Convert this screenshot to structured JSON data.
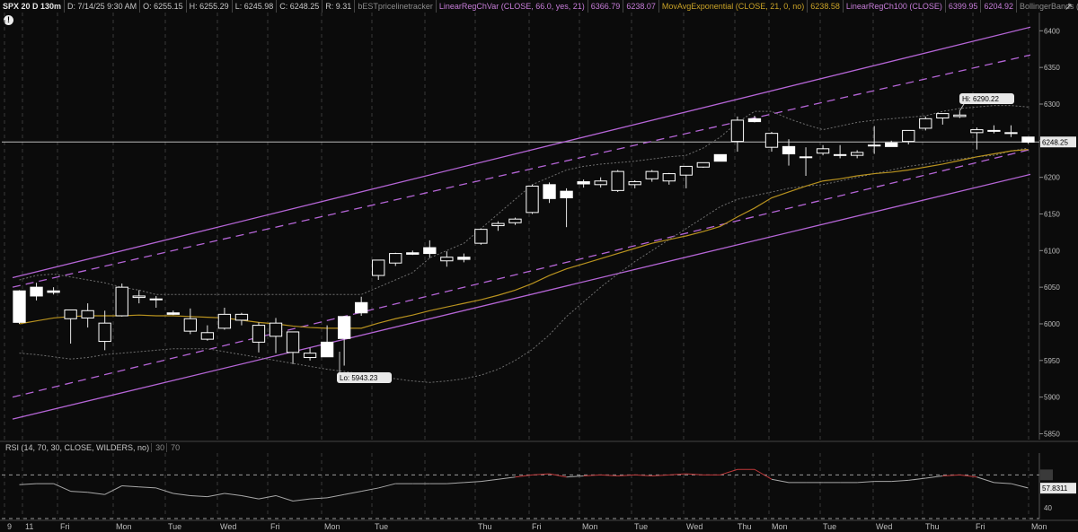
{
  "header": {
    "symbol": "SPX 20 D 130m",
    "date": "D: 7/14/25 9:30 AM",
    "open": "O: 6255.15",
    "high": "H: 6255.29",
    "low": "L: 6245.98",
    "close": "C: 6248.25",
    "range": "R: 9.31",
    "study1": "bESTpricelinetracker",
    "study2": "LinearRegChVar (CLOSE, 66.0, yes, 21)",
    "study2_v1": "6366.79",
    "study2_v2": "6238.07",
    "study3": "MovAvgExponential (CLOSE, 21, 0, no)",
    "study3_v": "6238.58",
    "study4": "LinearRegCh100 (CLOSE)",
    "study4_v1": "6399.95",
    "study4_v2": "6204.92",
    "study5": "BollingerBands (CLOSE, 0, 20, -2.0, 2.0,..."
  },
  "rsi_header": {
    "label": "RSI (14, 70, 30, CLOSE, WILDERS, no)",
    "lv1": "30",
    "lv2": "70"
  },
  "colors": {
    "background": "#0b0b0b",
    "candle": "#ffffff",
    "linreg100": "#b565d6",
    "linregvar": "#b565d6",
    "ema": "#b8921f",
    "bollinger": "#6f6f6f",
    "rsi": "#a8a8a8",
    "rsi_overbought": "#c0393b",
    "grid": "#3a3a3a"
  },
  "icons": {
    "alert": "alert-icon",
    "expand": "expand-icon"
  },
  "chart_data": {
    "type": "candlestick",
    "price_axis": {
      "ticks": [
        "6400",
        "6350",
        "6300",
        "6250",
        "6200",
        "6150",
        "6100",
        "6050",
        "6000",
        "5950",
        "5900",
        "5850"
      ],
      "ylim": [
        5842,
        6420
      ]
    },
    "current_price_label": "6248.25",
    "annotations": {
      "high": "Hi: 6290.22",
      "low": "Lo: 5943.23"
    },
    "x_labels": [
      "9",
      "11",
      "Fri",
      "Mon",
      "Tue",
      "Wed",
      "Fri",
      "Mon",
      "Tue",
      "Thu",
      "Fri",
      "Mon",
      "Tue",
      "Wed",
      "Thu",
      "Mon",
      "Tue",
      "Wed",
      "Thu",
      "Fri",
      "Mon"
    ],
    "candles": [
      [
        6045,
        6046,
        6000,
        6002
      ],
      [
        6050,
        6056,
        6032,
        6038
      ],
      [
        6045,
        6050,
        6040,
        6043
      ],
      [
        6007,
        6018,
        5973,
        6019
      ],
      [
        6008,
        6028,
        5995,
        6018
      ],
      [
        5976,
        6018,
        5964,
        6001
      ],
      [
        6011,
        6055,
        6010,
        6050
      ],
      [
        6036,
        6046,
        6028,
        6038
      ],
      [
        6034,
        6038,
        6022,
        6033
      ],
      [
        6015,
        6018,
        6012,
        6013
      ],
      [
        5990,
        6021,
        5986,
        6007
      ],
      [
        5979,
        5998,
        5977,
        5988
      ],
      [
        5994,
        6022,
        5992,
        6013
      ],
      [
        6005,
        6015,
        5998,
        6013
      ],
      [
        5975,
        6002,
        5961,
        5998
      ],
      [
        5983,
        6008,
        5960,
        6001
      ],
      [
        5961,
        5989,
        5945,
        5989
      ],
      [
        5954,
        5967,
        5950,
        5960
      ],
      [
        5975,
        5998,
        5960,
        5955
      ],
      [
        6010,
        6010,
        5943,
        5980
      ],
      [
        6029,
        6037,
        6011,
        6015
      ],
      [
        6066,
        6085,
        6060,
        6087
      ],
      [
        6083,
        6097,
        6079,
        6096
      ],
      [
        6097,
        6100,
        6094,
        6095
      ],
      [
        6104,
        6114,
        6090,
        6096
      ],
      [
        6086,
        6099,
        6078,
        6091
      ],
      [
        6091,
        6096,
        6084,
        6088
      ],
      [
        6110,
        6130,
        6108,
        6129
      ],
      [
        6134,
        6140,
        6127,
        6137
      ],
      [
        6138,
        6145,
        6135,
        6143
      ],
      [
        6152,
        6190,
        6150,
        6188
      ],
      [
        6190,
        6193,
        6165,
        6171
      ],
      [
        6181,
        6185,
        6132,
        6172
      ],
      [
        6194,
        6197,
        6186,
        6191
      ],
      [
        6190,
        6200,
        6186,
        6195
      ],
      [
        6182,
        6210,
        6180,
        6208
      ],
      [
        6190,
        6196,
        6185,
        6194
      ],
      [
        6198,
        6210,
        6194,
        6208
      ],
      [
        6195,
        6206,
        6190,
        6205
      ],
      [
        6203,
        6215,
        6185,
        6215
      ],
      [
        6214,
        6220,
        6213,
        6220
      ],
      [
        6231,
        6230,
        6228,
        6222
      ],
      [
        6249,
        6283,
        6235,
        6278
      ],
      [
        6280,
        6284,
        6275,
        6276
      ],
      [
        6241,
        6262,
        6235,
        6260
      ],
      [
        6242,
        6252,
        6216,
        6232
      ],
      [
        6227,
        6241,
        6202,
        6228
      ],
      [
        6233,
        6244,
        6230,
        6239
      ],
      [
        6230,
        6244,
        6226,
        6231
      ],
      [
        6230,
        6237,
        6226,
        6234
      ],
      [
        6244,
        6270,
        6232,
        6244
      ],
      [
        6247,
        6250,
        6246,
        6242
      ],
      [
        6249,
        6264,
        6245,
        6264
      ],
      [
        6267,
        6283,
        6264,
        6280
      ],
      [
        6281,
        6285,
        6272,
        6287
      ],
      [
        6283,
        6290,
        6281,
        6285
      ],
      [
        6261,
        6268,
        6238,
        6265
      ],
      [
        6263,
        6271,
        6260,
        6264
      ],
      [
        6261,
        6271,
        6255,
        6260
      ],
      [
        6255,
        6255,
        6246,
        6248
      ]
    ],
    "ema": [
      6000,
      6004,
      6008,
      6010,
      6011,
      6011,
      6011,
      6012,
      6011,
      6011,
      6010,
      6009,
      6008,
      6005,
      6002,
      6000,
      5997,
      5995,
      5994,
      5994,
      5994,
      6001,
      6007,
      6012,
      6018,
      6023,
      6028,
      6033,
      6039,
      6046,
      6055,
      6066,
      6075,
      6082,
      6089,
      6096,
      6103,
      6110,
      6115,
      6120,
      6126,
      6133,
      6146,
      6158,
      6172,
      6180,
      6188,
      6195,
      6198,
      6202,
      6205,
      6207,
      6210,
      6214,
      6218,
      6223,
      6228,
      6232,
      6236,
      6238
    ],
    "bollinger_upper": [
      6060,
      6066,
      6068,
      6064,
      6060,
      6056,
      6050,
      6046,
      6040,
      6040,
      6040,
      6040,
      6040,
      6040,
      6040,
      6040,
      6040,
      6040,
      6040,
      6040,
      6040,
      6050,
      6060,
      6070,
      6090,
      6100,
      6110,
      6130,
      6150,
      6170,
      6190,
      6200,
      6210,
      6215,
      6218,
      6220,
      6222,
      6225,
      6228,
      6230,
      6240,
      6255,
      6275,
      6290,
      6290,
      6280,
      6272,
      6265,
      6270,
      6275,
      6278,
      6280,
      6282,
      6284,
      6290,
      6294,
      6296,
      6298,
      6298,
      6296
    ],
    "bollinger_lower": [
      5960,
      5958,
      5955,
      5952,
      5954,
      5958,
      5960,
      5962,
      5964,
      5966,
      5966,
      5966,
      5962,
      5958,
      5954,
      5950,
      5946,
      5942,
      5938,
      5935,
      5932,
      5928,
      5925,
      5922,
      5920,
      5922,
      5925,
      5930,
      5938,
      5950,
      5965,
      5985,
      6010,
      6030,
      6050,
      6068,
      6085,
      6100,
      6115,
      6130,
      6145,
      6160,
      6170,
      6175,
      6180,
      6185,
      6188,
      6190,
      6195,
      6200,
      6205,
      6210,
      6215,
      6218,
      6222,
      6225,
      6228,
      6230,
      6236,
      6240
    ],
    "linreg100_upper": [
      6063,
      6405
    ],
    "linreg100_lower": [
      5870,
      6204
    ],
    "linregvar_upper": [
      6050,
      6367
    ],
    "linregvar_lower": [
      5900,
      6238
    ],
    "rsi": {
      "ylim": [
        30,
        90
      ],
      "levels": [
        30,
        70
      ],
      "ticks": [
        "70",
        "40"
      ],
      "current_label": "57.8311",
      "values": [
        61,
        62,
        62,
        55,
        54,
        52,
        60,
        59,
        58,
        53,
        51,
        50,
        53,
        51,
        48,
        51,
        46,
        48,
        49,
        52,
        55,
        58,
        62,
        62,
        62,
        62,
        63,
        64,
        66,
        68,
        70,
        71,
        68,
        69,
        70,
        69,
        70,
        69,
        70,
        71,
        70,
        70,
        75,
        75,
        66,
        63,
        63,
        63,
        63,
        63,
        64,
        64,
        65,
        67,
        69,
        70,
        68,
        63,
        62,
        58
      ]
    }
  }
}
